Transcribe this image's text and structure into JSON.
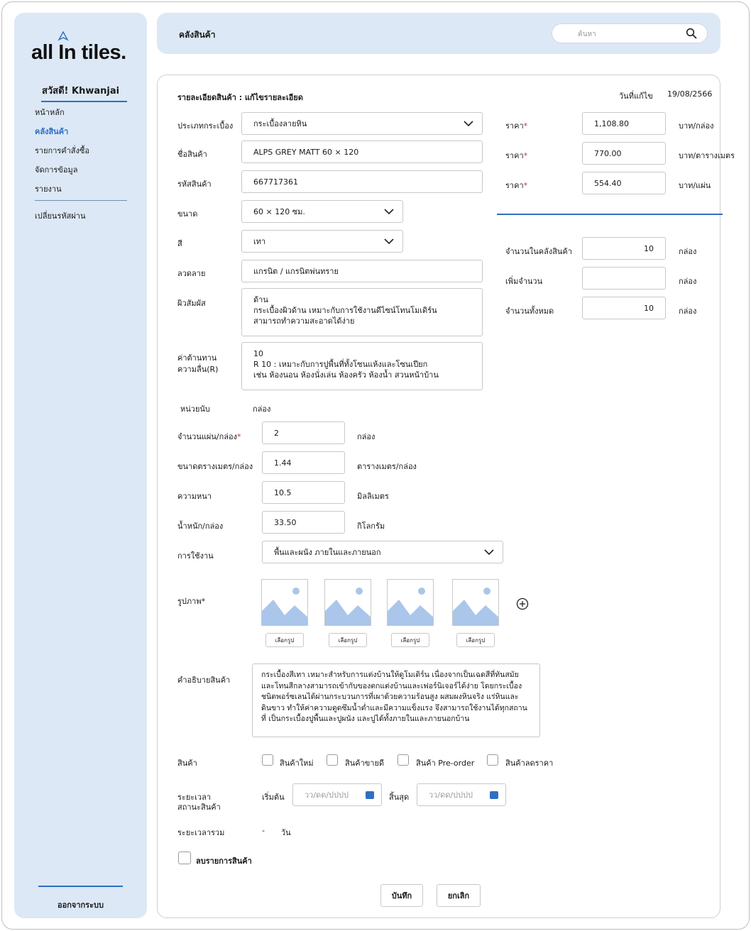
{
  "brand": {
    "logo_text": "all In tiles.",
    "accent": "#2f6fc4",
    "panel_bg": "#dce8f5"
  },
  "sidebar": {
    "greeting": "สวัสดี! Khwanjai",
    "items": [
      {
        "label": "หน้าหลัก"
      },
      {
        "label": "คลังสินค้า",
        "active": true
      },
      {
        "label": "รายการคำสั่งซื้อ"
      },
      {
        "label": "จัดการข้อมูล"
      },
      {
        "label": "รายงาน"
      }
    ],
    "change_password": "เปลี่ยนรหัสผ่าน",
    "logout": "ออกจากระบบ"
  },
  "header": {
    "title": "คลังสินค้า",
    "search_placeholder": "ค้นหา"
  },
  "form": {
    "title": "รายละเอียดสินค้า : แก้ไขรายละเอียด",
    "edit_date_label": "วันที่แก้ไข",
    "edit_date": "19/08/2566",
    "tile_type": {
      "label": "ประเภทกระเบื้อง",
      "value": "กระเบื้องลายหิน"
    },
    "product_name": {
      "label": "ชื่อสินค้า",
      "value": "ALPS GREY MATT 60 × 120"
    },
    "product_code": {
      "label": "รหัสสินค้า",
      "value": "667717361"
    },
    "size": {
      "label": "ขนาด",
      "value": "60 × 120 ซม."
    },
    "color": {
      "label": "สี",
      "value": "เทา"
    },
    "pattern": {
      "label": "ลวดลาย",
      "value": "แกรนิต / แกรนิตพ่นทราย"
    },
    "texture": {
      "label": "ผิวสัมผัส",
      "lines": [
        "ด้าน",
        "กระเบื้องผิวด้าน เหมาะกับการใช้งานดีไซน์โทนโมเดิร์น",
        "สามารถทำความสะอาดได้ง่าย"
      ]
    },
    "slip_resistance": {
      "label_1": "ค่าต้านทาน",
      "label_2": "ความลื่น(R)",
      "lines": [
        "10",
        "R 10 : เหมาะกับการปูพื้นที่ทั้งโซนแห้งและโซนเปียก",
        "เช่น ห้องนอน ห้องนั่งเล่น ห้องครัว ห้องน้ำ สวนหน้าบ้าน"
      ]
    },
    "unit": {
      "label": "หน่วยนับ",
      "value": "กล่อง"
    },
    "pieces_per_box": {
      "label": "จำนวนแผ่น/กล่อง",
      "required": "*",
      "value": "2",
      "unit": "กล่อง"
    },
    "sqm_per_box": {
      "label": "ขนาดตรางเมตร/กล่อง",
      "value": "1.44",
      "unit": "ตารางเมตร/กล่อง"
    },
    "thickness": {
      "label": "ความหนา",
      "value": "10.5",
      "unit": "มิลลิเมตร"
    },
    "weight": {
      "label": "น้ำหนัก/กล่อง",
      "value": "33.50",
      "unit": "กิโลกรัม"
    },
    "usage": {
      "label": "การใช้งาน",
      "value": "พื้นและผนัง ภายในและภายนอก"
    },
    "images": {
      "label": "รูปภาพ*",
      "pick_label": "เลือกรูป",
      "count": 4
    },
    "description": {
      "label": "คำอธิบายสินค้า",
      "lines": [
        "กระเบื้องสีเทา เหมาะสำหรับการแต่งบ้านให้ดูโมเดิร์น เนื่องจากเป็นเฉดสีที่ทันสมัย",
        "และโทนสีกลางสามารถเข้ากับของตกแต่งบ้านและเฟอร์นิเจอร์ได้ง่าย โดยกระเบื้อง",
        "ชนิดพอร์ซเลนได้ผ่านกระบวนการที่เผาด้วยความร้อนสูง ผสมผงหินจริง แร่หินและ",
        "ดินขาว ทำให้ค่าความดูดซึมน้ำต่ำและมีความแข็งแรง จึงสามารถใช้งานได้ทุกสถาน",
        "ที่ เป็นกระเบื้องปูพื้นและปูผนัง และปูได้ทั้งภายในและภายนอกบ้าน"
      ]
    },
    "product_flags": {
      "label": "สินค้า",
      "options": [
        "สินค้าใหม่",
        "สินค้าขายดี",
        "สินค้า Pre-order",
        "สินค้าลดราคา"
      ]
    },
    "status_period": {
      "label_1": "ระยะเวลา",
      "label_2": "สถานะสินค้า",
      "start_label": "เริ่มต้น",
      "end_label": "สิ้นสุด",
      "date_placeholder": "วว/ดด/ปปปป"
    },
    "total_period": {
      "label": "ระยะเวลารวม",
      "value": "-",
      "unit": "วัน"
    },
    "delete_label": "ลบรายการสินค้า",
    "save": "บันทึก",
    "cancel": "ยกเลิก"
  },
  "pricing": {
    "rows": [
      {
        "label": "ราคา",
        "required": "*",
        "value": "1,108.80",
        "unit": "บาท/กล่อง"
      },
      {
        "label": "ราคา",
        "required": "*",
        "value": "770.00",
        "unit": "บาท/ตารางเมตร"
      },
      {
        "label": "ราคา",
        "required": "*",
        "value": "554.40",
        "unit": "บาท/แผ่น"
      }
    ]
  },
  "stock": {
    "rows": [
      {
        "label": "จำนวนในคลังสินค้า",
        "value": "10",
        "unit": "กล่อง"
      },
      {
        "label": "เพิ่มจำนวน",
        "value": "",
        "unit": "กล่อง"
      },
      {
        "label": "จำนวนทั้งหมด",
        "value": "10",
        "unit": "กล่อง"
      }
    ]
  }
}
